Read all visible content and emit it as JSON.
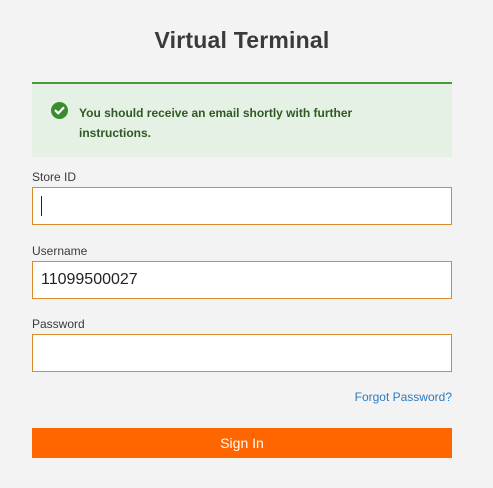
{
  "page": {
    "title": "Virtual Terminal"
  },
  "alert": {
    "type": "success",
    "icon": "check-circle-icon",
    "message": "You should receive an email shortly with further instructions.",
    "color": "#4a9a3a"
  },
  "form": {
    "store_id": {
      "label": "Store ID",
      "value": "",
      "focused": true
    },
    "username": {
      "label": "Username",
      "value": "11099500027"
    },
    "password": {
      "label": "Password",
      "value": ""
    },
    "forgot_password_label": "Forgot Password?",
    "sign_in_label": "Sign In"
  },
  "colors": {
    "accent": "#ff6600",
    "input_border": "#d98a2a",
    "link": "#2a7bbf",
    "background": "#f3f3f3"
  }
}
